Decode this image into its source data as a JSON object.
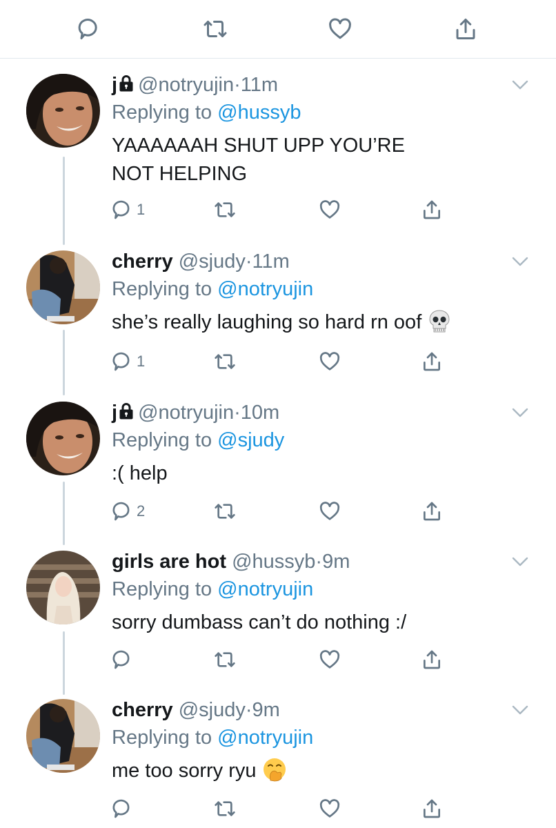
{
  "top_actions": {
    "reply_icon": "reply-icon",
    "retweet_icon": "retweet-icon",
    "like_icon": "like-icon",
    "share_icon": "share-icon"
  },
  "colors": {
    "link": "#1b95e0",
    "secondary": "#657786",
    "divider": "#e1e8ed",
    "thread": "#ccd6dd"
  },
  "tweets": [
    {
      "name": "j",
      "protected": true,
      "handle": "@notryujin",
      "separator": "·",
      "time": "11m",
      "replying_prefix": "Replying to",
      "replying_to": "@hussyb",
      "text_lines": [
        "YAAAAAAH SHUT UPP YOU’RE",
        "NOT HELPING"
      ],
      "reply_count": "1"
    },
    {
      "name": "cherry",
      "protected": false,
      "handle": "@sjudy",
      "separator": "·",
      "time": "11m",
      "replying_prefix": "Replying to",
      "replying_to": "@notryujin",
      "text_lines": [
        "she’s really laughing so hard rn oof"
      ],
      "emoji": "skull",
      "reply_count": "1"
    },
    {
      "name": "j",
      "protected": true,
      "handle": "@notryujin",
      "separator": "·",
      "time": "10m",
      "replying_prefix": "Replying to",
      "replying_to": "@sjudy",
      "text_lines": [
        ":( help"
      ],
      "reply_count": "2"
    },
    {
      "name": "girls are hot",
      "protected": false,
      "handle": "@hussyb",
      "separator": "·",
      "time": "9m",
      "replying_prefix": "Replying to",
      "replying_to": "@notryujin",
      "text_lines": [
        "sorry dumbass can’t do nothing :/"
      ],
      "reply_count": ""
    },
    {
      "name": "cherry",
      "protected": false,
      "handle": "@sjudy",
      "separator": "·",
      "time": "9m",
      "replying_prefix": "Replying to",
      "replying_to": "@notryujin",
      "text_lines": [
        "me too sorry ryu"
      ],
      "emoji": "hand-over-mouth",
      "reply_count": ""
    }
  ]
}
